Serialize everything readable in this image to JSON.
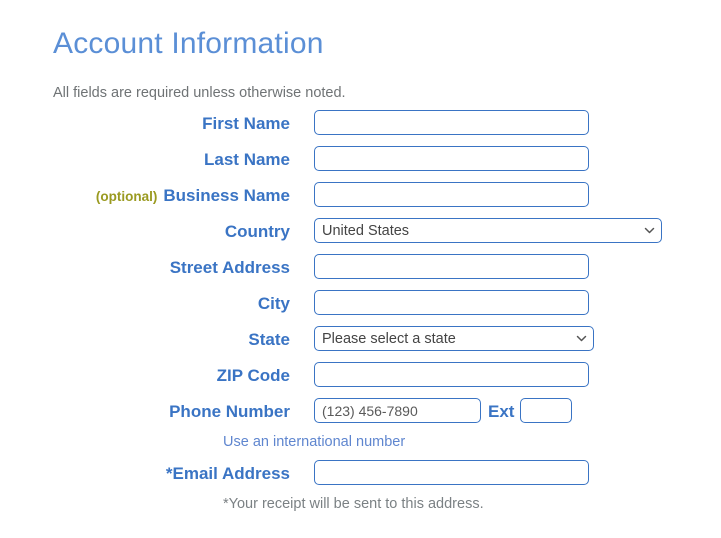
{
  "header": {
    "title": "Account Information",
    "subtitle": "All fields are required unless otherwise noted."
  },
  "colors": {
    "title": "#5b8fd6",
    "label": "#3a74c4",
    "optional": "#9a9a20",
    "border": "#3a74c4",
    "note_gray": "#7b8184",
    "link": "#5f86cf",
    "background": "#ffffff"
  },
  "form": {
    "rows": [
      {
        "label": "First Name",
        "optional_tag": "",
        "control": "text",
        "value": "",
        "placeholder": ""
      },
      {
        "label": "Last Name",
        "optional_tag": "",
        "control": "text",
        "value": "",
        "placeholder": ""
      },
      {
        "label": "Business Name",
        "optional_tag": "(optional)",
        "control": "text",
        "value": "",
        "placeholder": ""
      },
      {
        "label": "Country",
        "optional_tag": "",
        "control": "select",
        "value": "United States",
        "options": [
          "United States"
        ]
      },
      {
        "label": "Street Address",
        "optional_tag": "",
        "control": "text",
        "value": "",
        "placeholder": ""
      },
      {
        "label": "City",
        "optional_tag": "",
        "control": "text",
        "value": "",
        "placeholder": ""
      },
      {
        "label": "State",
        "optional_tag": "",
        "control": "select",
        "value": "Please select a state",
        "options": [
          "Please select a state"
        ]
      },
      {
        "label": "ZIP Code",
        "optional_tag": "",
        "control": "text",
        "value": "",
        "placeholder": ""
      }
    ],
    "phone": {
      "label": "Phone Number",
      "placeholder": "(123) 456-7890",
      "value": "",
      "ext_label": "Ext",
      "ext_value": "",
      "international_link": "Use an international number"
    },
    "email": {
      "label": "*Email Address",
      "value": "",
      "placeholder": "",
      "note": "*Your receipt will be sent to this address."
    }
  },
  "icons": {
    "chevron_down": "chevron-down-icon"
  }
}
